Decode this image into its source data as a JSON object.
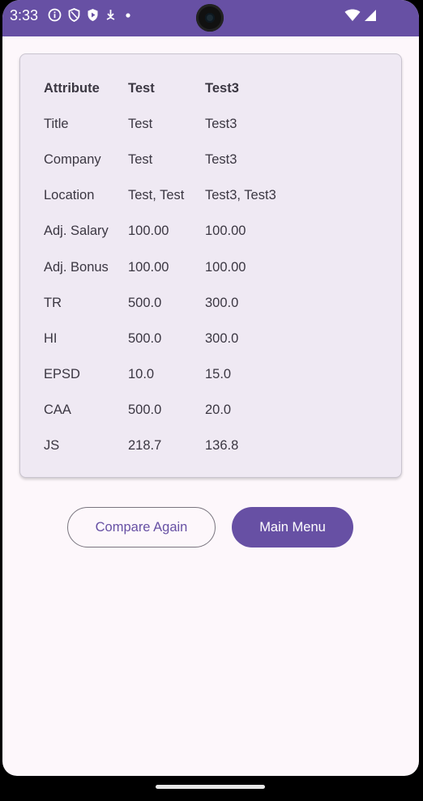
{
  "status_bar": {
    "time": "3:33",
    "left_icons": [
      "info-icon",
      "shield-icon",
      "play-protect-icon",
      "download-icon",
      "dot-icon"
    ],
    "right_icons": [
      "wifi-icon",
      "signal-icon"
    ],
    "background": "#6750a4"
  },
  "table": {
    "headers": [
      "Attribute",
      "Test",
      "Test3"
    ],
    "rows": [
      [
        "Title",
        "Test",
        "Test3"
      ],
      [
        "Company",
        "Test",
        "Test3"
      ],
      [
        "Location",
        "Test, Test",
        "Test3, Test3"
      ],
      [
        "Adj. Salary",
        "100.00",
        "100.00"
      ],
      [
        "Adj. Bonus",
        "100.00",
        "100.00"
      ],
      [
        "TR",
        "500.0",
        "300.0"
      ],
      [
        "HI",
        "500.0",
        "300.0"
      ],
      [
        "EPSD",
        "10.0",
        "15.0"
      ],
      [
        "CAA",
        "500.0",
        "20.0"
      ],
      [
        "JS",
        "218.7",
        "136.8"
      ]
    ]
  },
  "buttons": {
    "compare_again": "Compare Again",
    "main_menu": "Main Menu"
  },
  "colors": {
    "accent": "#6750a4",
    "card_background": "#efe9f3",
    "screen_background": "#fdf7fb"
  }
}
